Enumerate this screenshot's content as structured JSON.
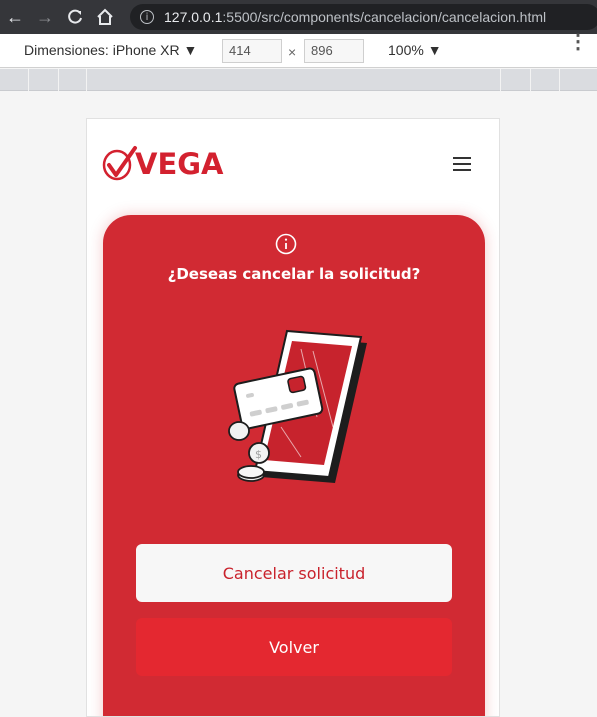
{
  "browser": {
    "url_host": "127.0.0.1",
    "url_rest": ":5500/src/components/cancelacion/cancelacion.html",
    "back_icon": "arrow-left",
    "forward_icon": "arrow-right",
    "reload_icon": "reload",
    "home_icon": "home"
  },
  "devtools": {
    "dimensions_label": "Dimensiones: iPhone XR ▼",
    "width_value": "414",
    "height_value": "896",
    "times": "×",
    "zoom_label": "100% ▼",
    "more_icon": "⋮"
  },
  "app": {
    "logo_text": "VEGA",
    "menu_icon": "hamburger-menu",
    "brand_color": "#d12a33",
    "card": {
      "title": "¿Deseas cancelar la solicitud?",
      "info_icon": "info-circle",
      "cancel_button": "Cancelar solicitud",
      "back_button": "Volver"
    }
  }
}
